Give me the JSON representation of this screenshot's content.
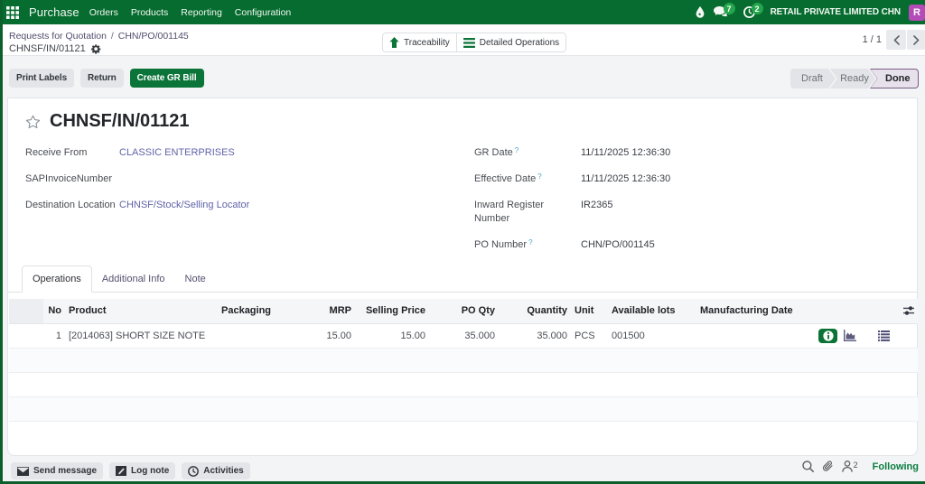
{
  "nav": {
    "app_name": "Purchase",
    "items": [
      {
        "label": "Orders"
      },
      {
        "label": "Products"
      },
      {
        "label": "Reporting"
      },
      {
        "label": "Configuration"
      }
    ],
    "messages_badge": "7",
    "activities_badge": "2",
    "company": "RETAIL PRIVATE LIMITED CHN",
    "avatar_initial": "R"
  },
  "breadcrumb": {
    "parent1": "Requests for Quotation",
    "separator": "/",
    "parent2": "CHN/PO/001145",
    "current": "CHNSF/IN/01121"
  },
  "control_buttons": {
    "traceability": "Traceability",
    "detailed_operations": "Detailed Operations"
  },
  "pager": {
    "count": "1 / 1"
  },
  "actions": {
    "print_labels": "Print Labels",
    "return": "Return",
    "create_gr_bill": "Create GR Bill"
  },
  "statusbar": {
    "stages": [
      "Draft",
      "Ready",
      "Done"
    ],
    "active": "Done"
  },
  "form": {
    "title": "CHNSF/IN/01121",
    "left_fields": [
      {
        "label": "Receive From",
        "value": "CLASSIC ENTERPRISES",
        "is_link": true
      },
      {
        "label": "SAPInvoiceNumber",
        "value": "",
        "is_link": false
      },
      {
        "label": "Destination Location",
        "value": "CHNSF/Stock/Selling Locator",
        "is_link": true
      }
    ],
    "right_fields": [
      {
        "label": "GR Date",
        "help": "?",
        "value": "11/11/2025 12:36:30"
      },
      {
        "label": "Effective Date",
        "help": "?",
        "value": "11/11/2025 12:36:30"
      },
      {
        "label": "Inward Register Number",
        "help": "",
        "value": "IR2365"
      },
      {
        "label": "PO Number",
        "help": "?",
        "value": "CHN/PO/001145"
      }
    ]
  },
  "tabs": [
    {
      "label": "Operations",
      "active": true
    },
    {
      "label": "Additional Info",
      "active": false
    },
    {
      "label": "Note",
      "active": false
    }
  ],
  "table": {
    "headers": [
      "No",
      "Product",
      "Packaging",
      "MRP",
      "Selling Price",
      "PO Qty",
      "Quantity",
      "Unit",
      "Available lots",
      "Manufacturing Date"
    ],
    "rows": [
      {
        "no": "1",
        "product": "[2014063] SHORT SIZE NOTE",
        "packaging": "",
        "mrp": "15.00",
        "selling_price": "15.00",
        "po_qty": "35.000",
        "quantity": "35.000",
        "unit": "PCS",
        "available_lots": "001500",
        "manufacturing_date": ""
      }
    ]
  },
  "chatter": {
    "send_message": "Send message",
    "log_note": "Log note",
    "activities": "Activities",
    "followers_count": "2",
    "following": "Following"
  },
  "colors": {
    "navbar_green": "#066c2f",
    "accent_green": "#0b7438",
    "badge_green": "#23a64c",
    "avatar_purple": "#b44cb8",
    "link_indigo": "#6064a8",
    "done_bg": "#e6e1ea",
    "done_border": "#7b5c86"
  }
}
